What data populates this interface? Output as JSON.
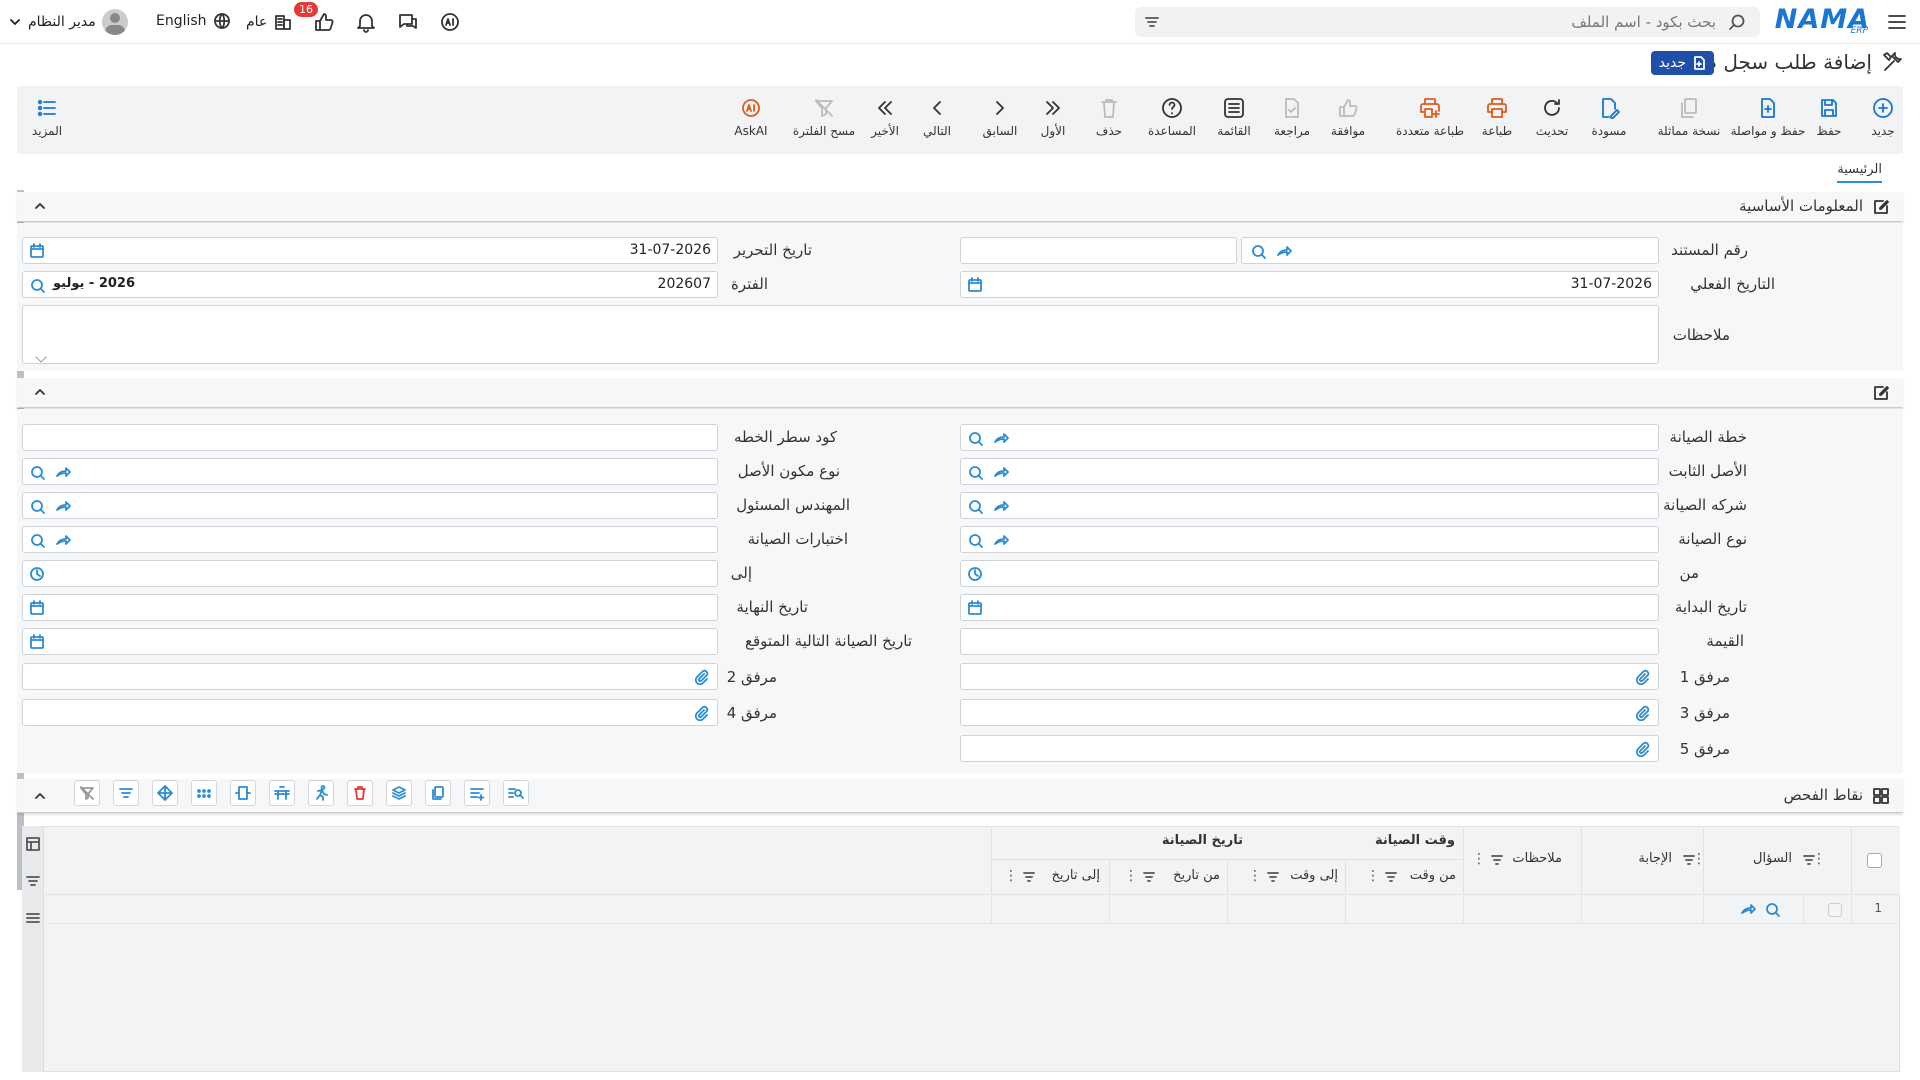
{
  "header": {
    "brand": "NAMA",
    "brand_sub": "ERP",
    "search_placeholder": "بحث بكود - اسم الملف",
    "user_name": "مدير النظام",
    "language": "English",
    "workspace": "عام",
    "notification_count": "16"
  },
  "page": {
    "title": "إضافة طلب سجل صيانة",
    "status_badge": "جديد"
  },
  "toolbar": {
    "new": "جديد",
    "save": "حفظ",
    "save_continue": "حفظ و مواصلة",
    "duplicate": "نسخة مماثلة",
    "draft": "مسودة",
    "refresh": "تحديث",
    "print": "طباعة",
    "multi_print": "طباعة متعددة",
    "approve": "موافقة",
    "review": "مراجعة",
    "list": "القائمة",
    "help": "المساعدة",
    "delete": "حذف",
    "first": "الأول",
    "previous": "السابق",
    "next": "التالي",
    "last": "الأخير",
    "clear_filter": "مسح الفلترة",
    "askai": "AskAI",
    "more": "المزيد"
  },
  "tabs": {
    "main": "الرئيسية"
  },
  "basic": {
    "section_title": "المعلومات الأساسية",
    "doc_number_label": "رقم المستند",
    "doc_number_value": "",
    "edit_date_label": "تاريخ التحرير",
    "edit_date_value": "31-07-2026",
    "actual_date_label": "التاريخ الفعلي",
    "actual_date_value": "31-07-2026",
    "period_label": "الفترة",
    "period_value": "202607",
    "period_name": "2026 - يوليو",
    "notes_label": "ملاحظات",
    "notes_value": ""
  },
  "details": {
    "plan_label": "خطة الصيانة",
    "plan_line_label": "كود سطر الخطه",
    "fixed_asset_label": "الأصل الثابت",
    "component_type_label": "نوع مكون الأصل",
    "company_label": "شركه الصيانة",
    "engineer_label": "المهندس المسئول",
    "type_label": "نوع الصيانة",
    "tests_label": "اختبارات الصيانة",
    "from_label": "من",
    "to_label": "إلى",
    "start_date_label": "تاريخ البداية",
    "end_date_label": "تاريخ النهاية",
    "value_label": "القيمة",
    "next_date_label": "تاريخ الصيانة التالية المتوقع",
    "att1_label": "مرفق 1",
    "att2_label": "مرفق 2",
    "att3_label": "مرفق 3",
    "att4_label": "مرفق 4",
    "att5_label": "مرفق 5"
  },
  "checkpoints": {
    "section_title": "نقاط الفحص",
    "col_question": "السؤال",
    "col_answer": "الإجابة",
    "col_notes": "ملاحظات",
    "group_time": "وقت الصيانة",
    "group_date": "تاريخ الصيانة",
    "col_from_time": "من وقت",
    "col_to_time": "إلى وقت",
    "col_from_date": "من تاريخ",
    "col_to_date": "إلى تاريخ",
    "row_number": "1"
  }
}
